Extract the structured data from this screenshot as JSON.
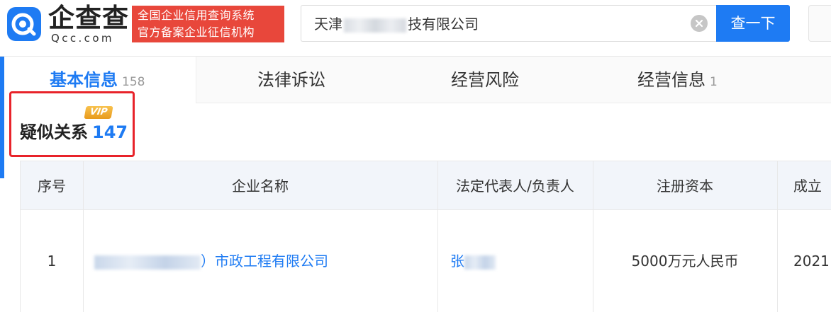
{
  "brand": {
    "logo_text": "企查查",
    "logo_sub": "Qcc.com",
    "slogan_line1": "全国企业信用查询系统",
    "slogan_line2": "官方备案企业征信机构",
    "primary_color": "#1e7bf3",
    "slogan_color": "#e8473b"
  },
  "search": {
    "query_prefix": "天津",
    "query_suffix": "技有限公司",
    "button_label": "查一下"
  },
  "tabs": [
    {
      "label": "基本信息",
      "count": "158",
      "active": true
    },
    {
      "label": "法律诉讼",
      "count": "",
      "active": false
    },
    {
      "label": "经营风险",
      "count": "",
      "active": false
    },
    {
      "label": "经营信息",
      "count": "1",
      "active": false
    }
  ],
  "section": {
    "badge": "VIP",
    "title": "疑似关系",
    "count": "147"
  },
  "table": {
    "columns": [
      "序号",
      "企业名称",
      "法定代表人/负责人",
      "注册资本",
      "成立"
    ],
    "rows": [
      {
        "index": "1",
        "company_visible": "）市政工程有限公司",
        "legal_rep_visible": "张",
        "capital": "5000万元人民币",
        "established": "2021"
      }
    ]
  }
}
